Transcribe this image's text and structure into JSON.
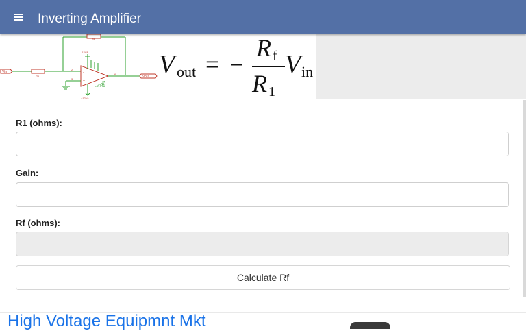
{
  "app_bar": {
    "title": "Inverting Amplifier",
    "menu_icon": "hamburger-menu-icon",
    "background": "#5370a6"
  },
  "circuit": {
    "labels": {
      "vin": "Vin",
      "vout": "Vout",
      "r1": "R1",
      "rf": "Rf",
      "neg_supply": "-12VA",
      "pos_supply": "+12VA",
      "ic_name": "U7",
      "ic_part": "LM741",
      "pin2": "2",
      "pin3": "3",
      "pin6": "6"
    }
  },
  "equation": {
    "lhs": "V",
    "lhs_sub": "out",
    "equals": "=",
    "minus": "−",
    "numerator": "R",
    "numerator_sub": "f",
    "denominator": "R",
    "denominator_sub": "1",
    "rhs": "V",
    "rhs_sub": "in"
  },
  "form": {
    "r1_label": "R1 (ohms):",
    "r1_value": "",
    "gain_label": "Gain:",
    "gain_value": "",
    "rf_label": "Rf (ohms):",
    "rf_value": "",
    "calculate_label": "Calculate Rf"
  },
  "ad": {
    "text": "High Voltage Equipmnt Mkt"
  }
}
